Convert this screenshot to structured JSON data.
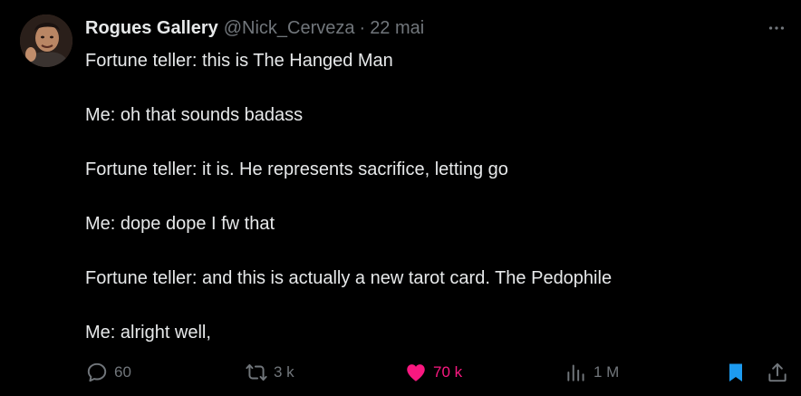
{
  "author": {
    "display_name": "Rogues Gallery",
    "handle": "@Nick_Cerveza",
    "separator": "·",
    "date": "22 mai"
  },
  "tweet": {
    "lines": [
      "Fortune teller: this is The Hanged Man",
      "Me: oh that sounds badass",
      "Fortune teller: it is. He represents sacrifice, letting go",
      "Me: dope dope I fw that",
      "Fortune teller: and this is actually a new tarot card. The Pedophile",
      "Me: alright well,"
    ]
  },
  "actions": {
    "reply_count": "60",
    "repost_count": "3 k",
    "like_count": "70 k",
    "views_count": "1 M"
  },
  "icons": {
    "more": "more-icon",
    "reply": "reply-icon",
    "repost": "repost-icon",
    "like": "heart-icon",
    "views": "views-icon",
    "bookmark": "bookmark-icon",
    "share": "share-icon"
  },
  "colors": {
    "background": "#000000",
    "text": "#e7e9ea",
    "muted": "#71767b",
    "like": "#f91880",
    "bookmark": "#1d9bf0"
  }
}
